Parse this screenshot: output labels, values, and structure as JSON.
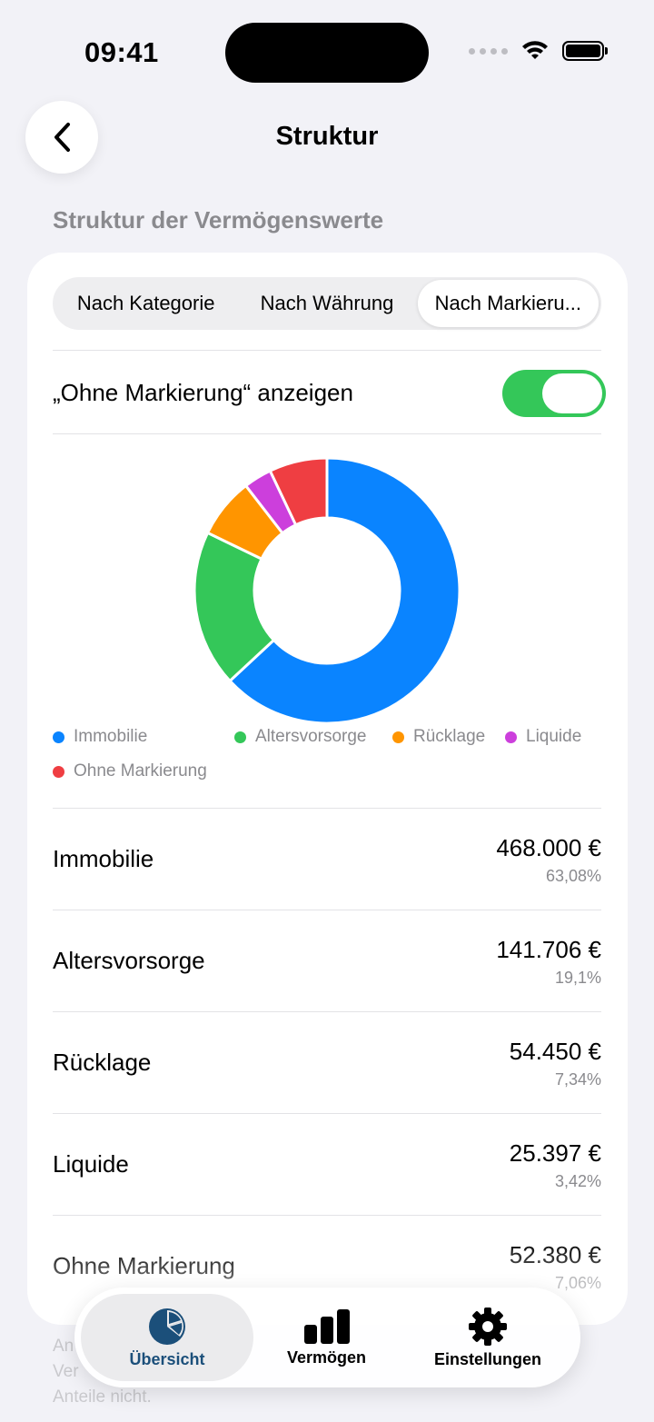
{
  "status": {
    "time": "09:41"
  },
  "header": {
    "title": "Struktur"
  },
  "section_title": "Struktur der Vermögenswerte",
  "segments": [
    {
      "label": "Nach Kategorie",
      "active": false
    },
    {
      "label": "Nach Währung",
      "active": false
    },
    {
      "label": "Nach Markieru...",
      "active": true
    }
  ],
  "toggle": {
    "label": "„Ohne Markierung“ anzeigen",
    "on": true
  },
  "colors": {
    "accent": "#1b4f7a",
    "toggle_on": "#34c759"
  },
  "chart_data": {
    "type": "pie",
    "style": "donut",
    "categories": [
      "Immobilie",
      "Altersvorsorge",
      "Rücklage",
      "Liquide",
      "Ohne Markierung"
    ],
    "values": [
      468000,
      141706,
      54450,
      25397,
      52380
    ],
    "percentages": [
      63.08,
      19.1,
      7.34,
      3.42,
      7.06
    ],
    "colors": [
      "#0a84ff",
      "#34c759",
      "#ff9500",
      "#cc3fdc",
      "#ef3e42"
    ],
    "legend_position": "bottom"
  },
  "legend": [
    {
      "label": "Immobilie",
      "color": "#0a84ff"
    },
    {
      "label": "Altersvorsorge",
      "color": "#34c759"
    },
    {
      "label": "Rücklage",
      "color": "#ff9500"
    },
    {
      "label": "Liquide",
      "color": "#cc3fdc"
    },
    {
      "label": "Ohne Markierung",
      "color": "#ef3e42"
    }
  ],
  "rows": [
    {
      "label": "Immobilie",
      "value": "468.000 €",
      "pct": "63,08%"
    },
    {
      "label": "Altersvorsorge",
      "value": "141.706 €",
      "pct": "19,1%"
    },
    {
      "label": "Rücklage",
      "value": "54.450 €",
      "pct": "7,34%"
    },
    {
      "label": "Liquide",
      "value": "25.397 €",
      "pct": "3,42%"
    },
    {
      "label": "Ohne Markierung",
      "value": "52.380 €",
      "pct": "7,06%"
    }
  ],
  "footnote": "An\nVer\nAnteile nicht.",
  "tabbar": [
    {
      "label": "Übersicht",
      "icon": "pie-chart-icon",
      "active": true
    },
    {
      "label": "Vermögen",
      "icon": "bar-chart-icon",
      "active": false
    },
    {
      "label": "Einstellungen",
      "icon": "gear-icon",
      "active": false
    }
  ]
}
